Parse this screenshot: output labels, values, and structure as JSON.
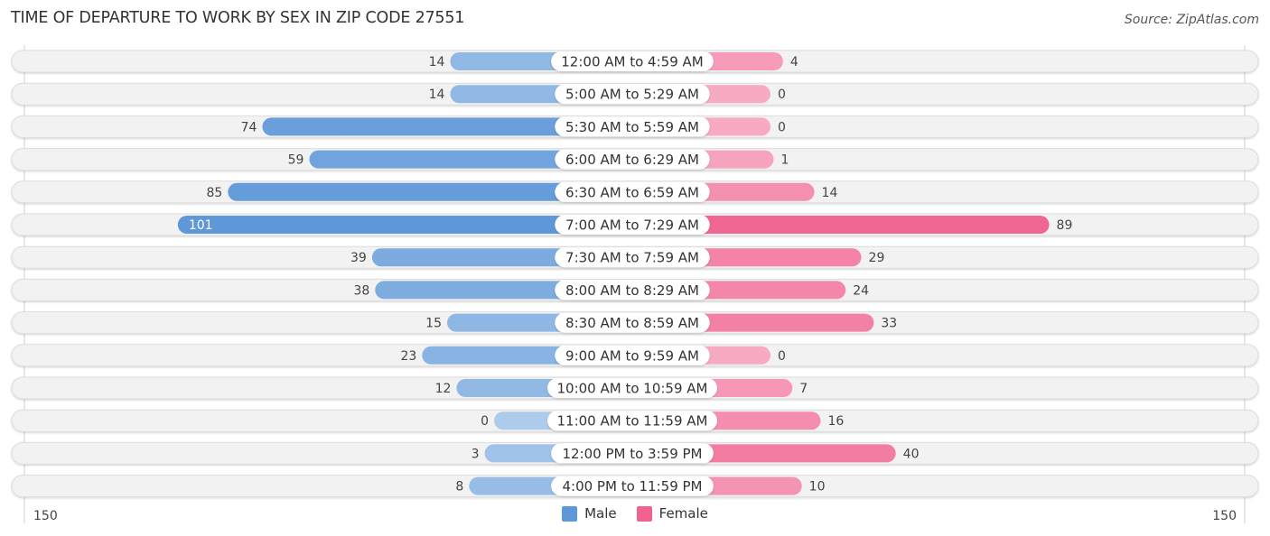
{
  "header": {
    "title": "TIME OF DEPARTURE TO WORK BY SEX IN ZIP CODE 27551",
    "source": "Source: ZipAtlas.com"
  },
  "legend": {
    "male_label": "Male",
    "female_label": "Female",
    "male_color": "#5f98d8",
    "female_color": "#f0628f"
  },
  "axis": {
    "left_tick": "150",
    "right_tick": "150"
  },
  "chart_data": {
    "type": "bar",
    "orientation": "horizontal-diverging",
    "title": "TIME OF DEPARTURE TO WORK BY SEX IN ZIP CODE 27551",
    "xlabel": "",
    "ylabel": "",
    "xlim": [
      -150,
      150
    ],
    "grid": false,
    "legend_position": "bottom-center",
    "categories": [
      "12:00 AM to 4:59 AM",
      "5:00 AM to 5:29 AM",
      "5:30 AM to 5:59 AM",
      "6:00 AM to 6:29 AM",
      "6:30 AM to 6:59 AM",
      "7:00 AM to 7:29 AM",
      "7:30 AM to 7:59 AM",
      "8:00 AM to 8:29 AM",
      "8:30 AM to 8:59 AM",
      "9:00 AM to 9:59 AM",
      "10:00 AM to 10:59 AM",
      "11:00 AM to 11:59 AM",
      "12:00 PM to 3:59 PM",
      "4:00 PM to 11:59 PM"
    ],
    "series": [
      {
        "name": "Male",
        "color": "#5f98d8",
        "values": [
          14,
          14,
          74,
          59,
          85,
          101,
          39,
          38,
          15,
          23,
          12,
          0,
          3,
          8
        ]
      },
      {
        "name": "Female",
        "color": "#f0628f",
        "values": [
          4,
          0,
          0,
          1,
          14,
          89,
          29,
          24,
          33,
          0,
          7,
          16,
          40,
          10
        ]
      }
    ]
  }
}
